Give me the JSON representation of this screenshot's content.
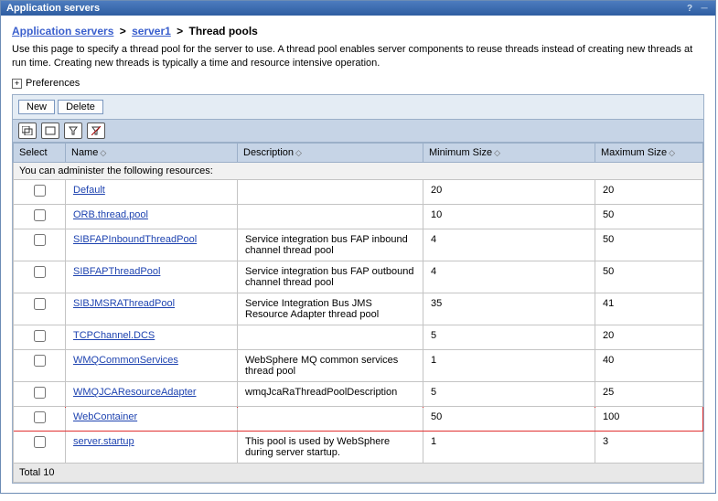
{
  "titlebar": {
    "title": "Application servers"
  },
  "breadcrumb": {
    "link1": "Application servers",
    "link2": "server1",
    "current": "Thread pools"
  },
  "description": "Use this page to specify a thread pool for the server to use. A thread pool enables server components to reuse threads instead of creating new threads at run time. Creating new threads is typically a time and resource intensive operation.",
  "preferences_label": "Preferences",
  "buttons": {
    "new": "New",
    "delete": "Delete"
  },
  "columns": {
    "select": "Select",
    "name": "Name",
    "description": "Description",
    "min": "Minimum Size",
    "max": "Maximum Size"
  },
  "admin_msg": "You can administer the following resources:",
  "rows": [
    {
      "name": "Default",
      "desc": "",
      "min": "20",
      "max": "20",
      "hl": false
    },
    {
      "name": "ORB.thread.pool",
      "desc": "",
      "min": "10",
      "max": "50",
      "hl": false
    },
    {
      "name": "SIBFAPInboundThreadPool",
      "desc": "Service integration bus FAP inbound channel thread pool",
      "min": "4",
      "max": "50",
      "hl": false
    },
    {
      "name": "SIBFAPThreadPool",
      "desc": "Service integration bus FAP outbound channel thread pool",
      "min": "4",
      "max": "50",
      "hl": false
    },
    {
      "name": "SIBJMSRAThreadPool",
      "desc": "Service Integration Bus JMS Resource Adapter thread pool",
      "min": "35",
      "max": "41",
      "hl": false
    },
    {
      "name": "TCPChannel.DCS",
      "desc": "",
      "min": "5",
      "max": "20",
      "hl": false
    },
    {
      "name": "WMQCommonServices",
      "desc": "WebSphere MQ common services thread pool",
      "min": "1",
      "max": "40",
      "hl": false
    },
    {
      "name": "WMQJCAResourceAdapter",
      "desc": "wmqJcaRaThreadPoolDescription",
      "min": "5",
      "max": "25",
      "hl": false
    },
    {
      "name": "WebContainer",
      "desc": "",
      "min": "50",
      "max": "100",
      "hl": true
    },
    {
      "name": "server.startup",
      "desc": "This pool is used by WebSphere during server startup.",
      "min": "1",
      "max": "3",
      "hl": false
    }
  ],
  "total_label": "Total 10"
}
